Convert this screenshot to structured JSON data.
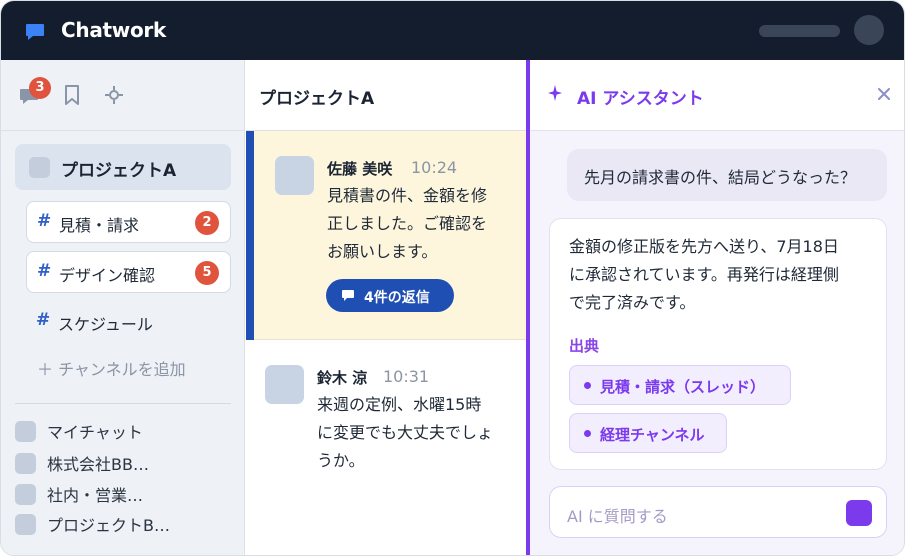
{
  "app": {
    "name": "Chatwork"
  },
  "sidebar": {
    "unread_badge": "3",
    "active_room": "プロジェクトA",
    "channels": [
      {
        "label": "見積・請求",
        "count": "2"
      },
      {
        "label": "デザイン確認",
        "count": "5"
      },
      {
        "label": "スケジュール",
        "count": ""
      }
    ],
    "add_channel": "＋ チャンネルを追加",
    "rooms": [
      "マイチャット",
      "株式会社BB…",
      "社内・営業…",
      "プロジェクトB…"
    ]
  },
  "thread": {
    "title": "プロジェクトA",
    "messages": [
      {
        "author": "佐藤 美咲",
        "time": "10:24",
        "lines": [
          "見積書の件、金額を修",
          "正しました。ご確認を",
          "お願いします。"
        ],
        "reply_label": "4件の返信"
      },
      {
        "author": "鈴木 涼",
        "time": "10:31",
        "lines": [
          "来週の定例、水曜15時",
          "に変更でも大丈夫でしょ",
          "うか。"
        ]
      }
    ]
  },
  "ai": {
    "title": "AI アシスタント",
    "user_message": "先月の請求書の件、結局どうなった？",
    "answer_lines": [
      "金額の修正版を先方へ送り、7月18日",
      "に承認されています。再発行は経理側",
      "で完了済みです。"
    ],
    "sources_heading": "出典",
    "sources": [
      "見積・請求（スレッド）",
      "経理チャンネル"
    ],
    "input_placeholder": "AI に質問する"
  },
  "colors": {
    "accent_purple": "#7c3aed",
    "brand_blue": "#1f4fb3",
    "badge_red": "#e0533d",
    "topbar": "#131d2e"
  }
}
